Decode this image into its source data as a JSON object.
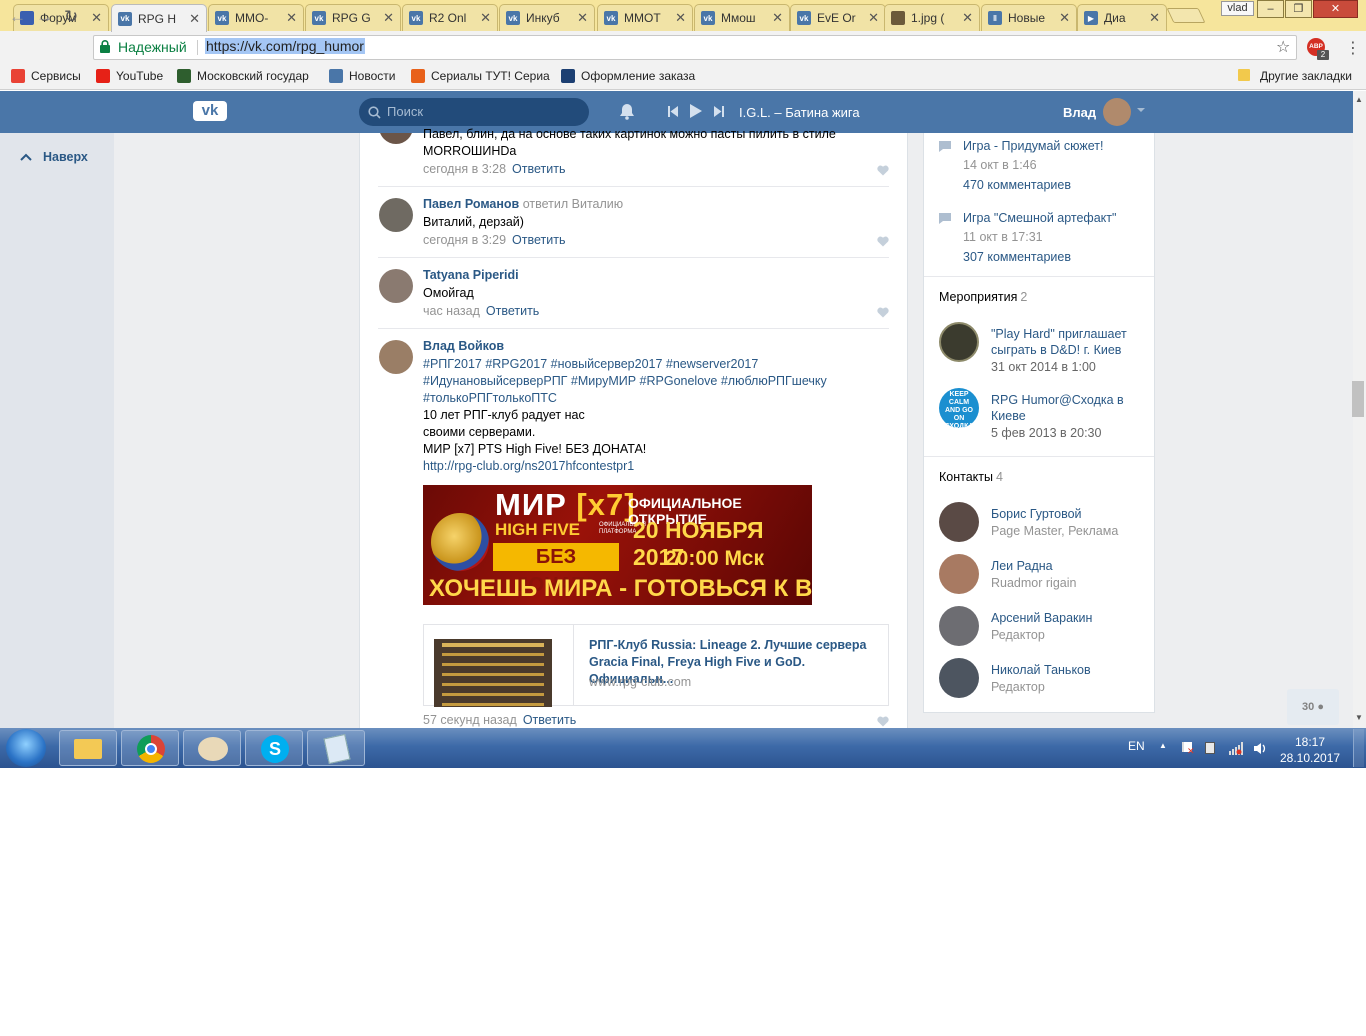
{
  "browser": {
    "tabs": [
      {
        "label": "Форум",
        "favicon": "rf-flag-icon",
        "color": "#3a5fb0",
        "active": false
      },
      {
        "label": "RPG H",
        "favicon": "vk-icon",
        "color": "#4a76a8",
        "active": true
      },
      {
        "label": "MMO-",
        "favicon": "vk-icon",
        "color": "#4a76a8",
        "active": false
      },
      {
        "label": "RPG G",
        "favicon": "vk-icon",
        "color": "#4a76a8",
        "active": false
      },
      {
        "label": "R2 Onl",
        "favicon": "vk-icon",
        "color": "#4a76a8",
        "active": false
      },
      {
        "label": "Инкуб",
        "favicon": "vk-icon",
        "color": "#4a76a8",
        "active": false
      },
      {
        "label": "MMOT",
        "favicon": "vk-icon",
        "color": "#4a76a8",
        "active": false
      },
      {
        "label": "Ммош",
        "favicon": "vk-icon",
        "color": "#4a76a8",
        "active": false
      },
      {
        "label": "EvE Or",
        "favicon": "vk-icon",
        "color": "#4a76a8",
        "active": false
      },
      {
        "label": "1.jpg (",
        "favicon": "image-icon",
        "color": "#6b5a3a",
        "active": false
      },
      {
        "label": "Новые",
        "favicon": "pause-icon",
        "color": "#4a76a8",
        "active": false
      },
      {
        "label": "Диа",
        "favicon": "play-icon",
        "color": "#4a76a8",
        "active": false
      }
    ],
    "profile_name": "vlad",
    "secure_label": "Надежный",
    "url": "https://vk.com/rpg_humor",
    "abp_badge": "2",
    "bookmarks": [
      {
        "label": "Сервисы",
        "icon": "apps-grid-icon",
        "color": "#e94235"
      },
      {
        "label": "YouTube",
        "icon": "youtube-icon",
        "color": "#e62117"
      },
      {
        "label": "Московский государ",
        "icon": "emblem-icon",
        "color": "#2e5e2e"
      },
      {
        "label": "Новости",
        "icon": "news-icon",
        "color": "#4a76a8"
      },
      {
        "label": "Сериалы ТУТ! Сериа",
        "icon": "fire-icon",
        "color": "#e8611a"
      },
      {
        "label": "Оформление заказа",
        "icon": "sp-icon",
        "color": "#1c3f72"
      }
    ],
    "other_bookmarks": "Другие закладки"
  },
  "vk": {
    "search_placeholder": "Поиск",
    "track": "I.G.L. – Батина жига",
    "user_name": "Влад",
    "back_to_top": "Наверх",
    "comments": [
      {
        "author": "",
        "text_lines": [
          "Павел, блин, да на основе таких картинок можно пасты пилить в стиле",
          "MORROШИНDa"
        ],
        "time": "сегодня в 3:28",
        "reply": "Ответить"
      },
      {
        "author": "Павел Романов",
        "replied": "ответил Виталию",
        "text_lines": [
          "Виталий, дерзай)"
        ],
        "time": "сегодня в 3:29",
        "reply": "Ответить"
      },
      {
        "author": "Tatyana Piperidi",
        "text_lines": [
          "Омойгад"
        ],
        "time": "час назад",
        "reply": "Ответить"
      },
      {
        "author": "Влад Войков",
        "hashtags": [
          "#РПГ2017 #RPG2017 #новыйсервер2017 #newserver2017",
          "#ИдунановыйсерверРПГ #МируМИР #RPGonelove #люблюРПГшечку",
          "#толькоРПГтолькоПТС"
        ],
        "text_lines": [
          "10 лет РПГ-клуб радует нас",
          "своими серверами.",
          "МИР [x7] PTS High Five! БЕЗ ДОНАТА!"
        ],
        "link": "http://rpg-club.org/ns2017hfcontestpr1",
        "time": "57 секунд назад",
        "reply": "Ответить"
      }
    ],
    "banner": {
      "title": "МИР",
      "rate": "[x7]",
      "subtitle": "HIGH FIVE",
      "platform": "ОФИЦИАЛЬНАЯ ПЛАТФОРМА",
      "opening": "ОФИЦИАЛЬНОЕ ОТКРЫТИЕ",
      "date": "20 НОЯБРЯ 2017",
      "time": "20:00 Мск",
      "no_donate": "БЕЗ ДОНАТА",
      "slogan": "ХОЧЕШЬ МИРА - ГОТОВЬСЯ К ВОЙНЕ"
    },
    "link_card": {
      "title": "РПГ-Клуб Russia: Lineage 2. Лучшие сервера Gracia Final, Freya High Five и GoD. Официальн...",
      "domain": "www.rpg-club.com"
    },
    "discussions": [
      {
        "title": "Игра - Придумай сюжет!",
        "date": "14 окт в 1:46",
        "comments": "470 комментариев"
      },
      {
        "title": "Игра \"Смешной артефакт\"",
        "date": "11 окт в 17:31",
        "comments": "307 комментариев"
      }
    ],
    "events": {
      "title": "Мероприятия",
      "count": "2",
      "items": [
        {
          "name_lines": [
            "\"Play Hard\" приглашает",
            "сыграть в D&D! г. Киев"
          ],
          "date": "31 окт 2014 в 1:00",
          "avatar_color": "#3b3b2e"
        },
        {
          "name_lines": [
            "RPG Humor@Сходка в",
            "Киеве"
          ],
          "date": "5 фев 2013 в 20:30",
          "avatar_color": "#1b8fd0",
          "avatar_text": "KEEP CALM AND GO ON СХОДКА"
        }
      ]
    },
    "contacts": {
      "title": "Контакты",
      "count": "4",
      "items": [
        {
          "name": "Борис Гуртовой",
          "role": "Page Master, Реклама",
          "avatar_color": "#5a4a45"
        },
        {
          "name": "Леи Радна",
          "role": "Ruadmor rigain",
          "avatar_color": "#a87a62"
        },
        {
          "name": "Арсений Варакин",
          "role": "Редактор",
          "avatar_color": "#6d6d72"
        },
        {
          "name": "Николай Таньков",
          "role": "Редактор",
          "avatar_color": "#4d5560"
        }
      ]
    },
    "online_count": "30"
  },
  "taskbar": {
    "language": "EN",
    "time": "18:17",
    "date": "28.10.2017",
    "apps": [
      "file-explorer-icon",
      "chrome-icon",
      "paint-icon",
      "skype-icon",
      "notepad-icon"
    ]
  }
}
